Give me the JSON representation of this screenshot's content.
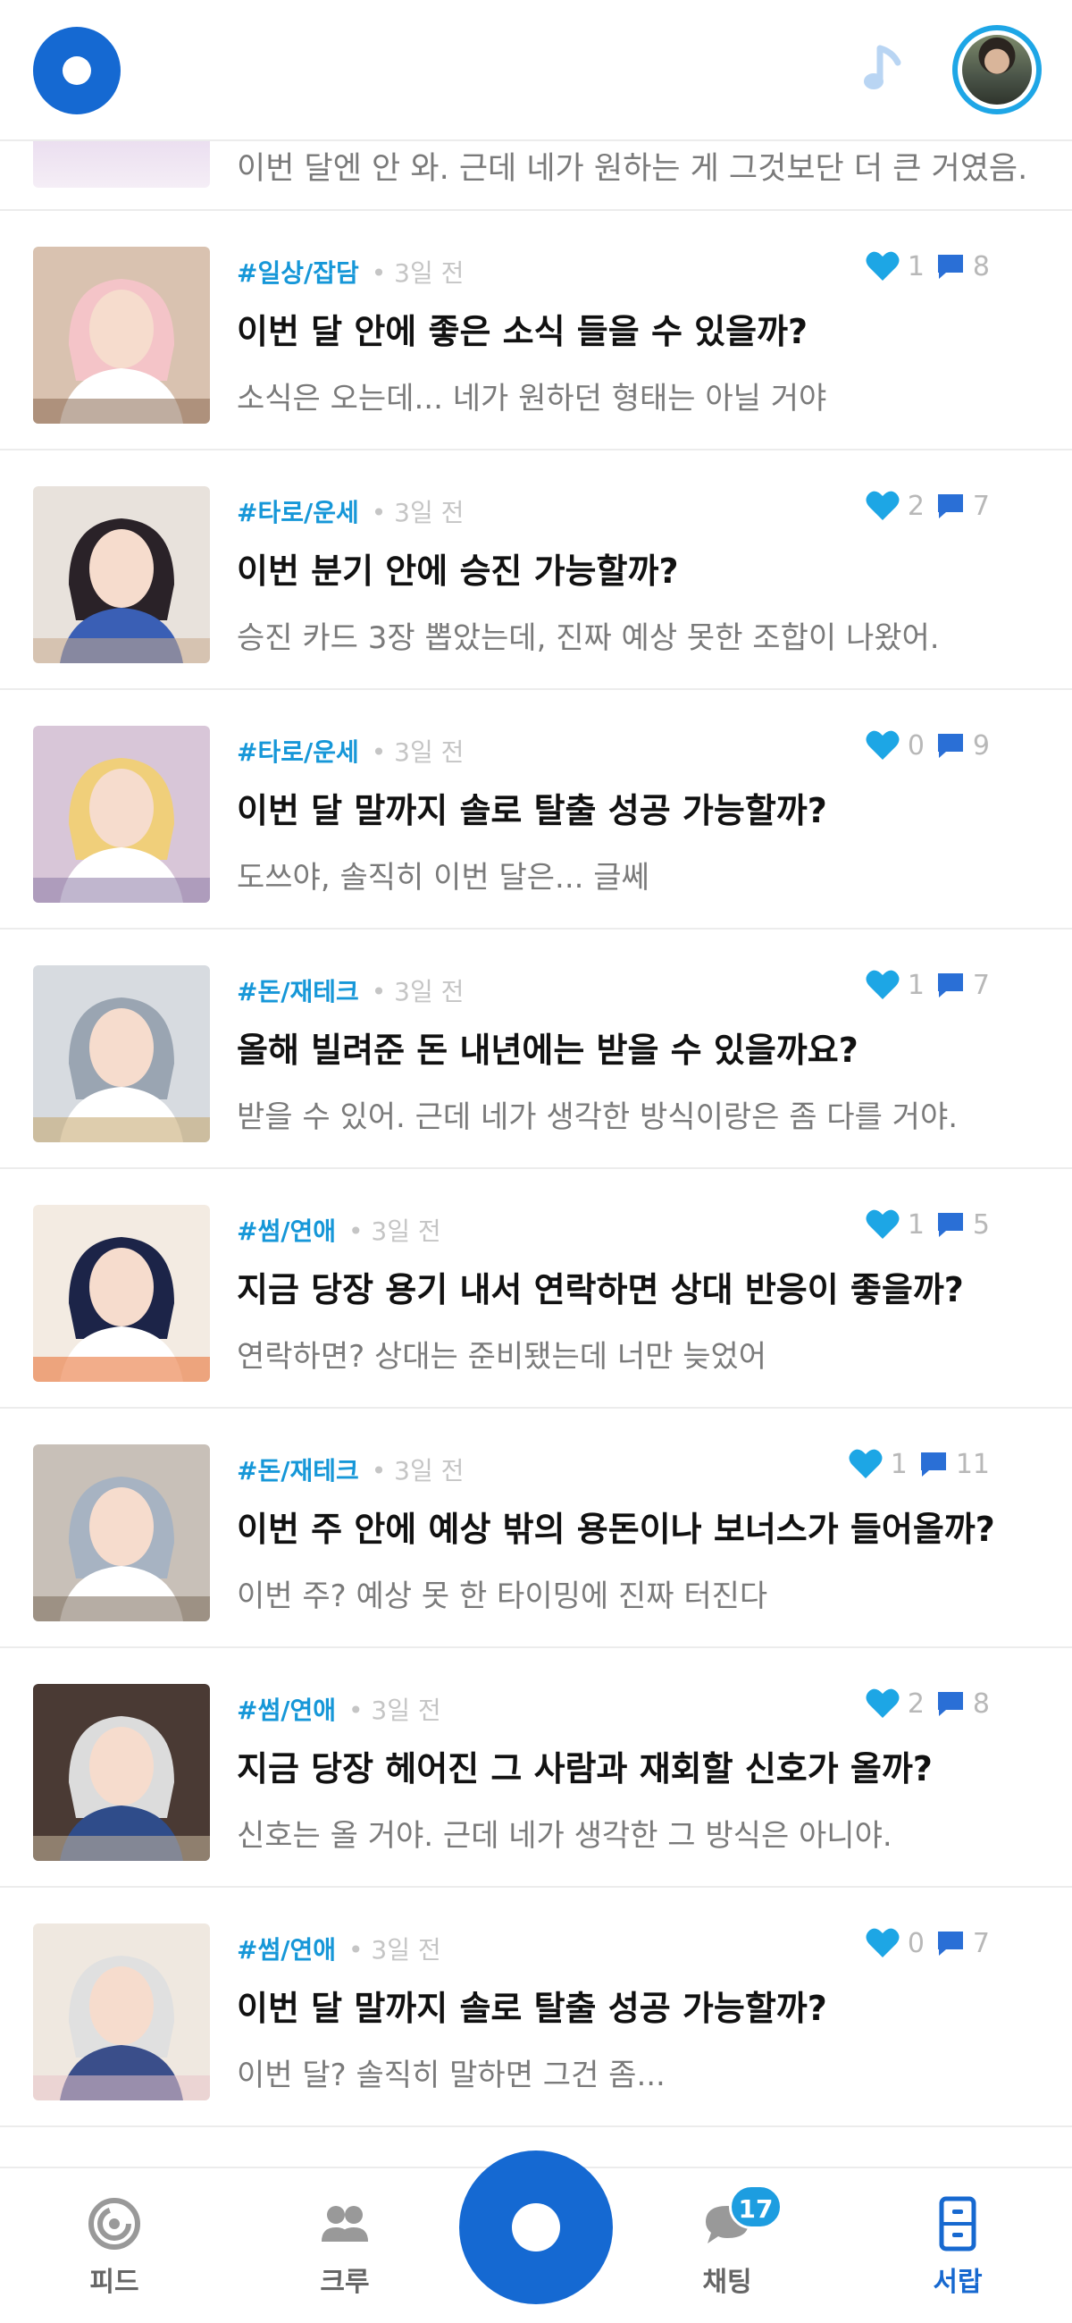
{
  "header": {
    "logo": "app-logo",
    "music_icon": "music-note-icon",
    "avatar": "profile-avatar"
  },
  "partial_row": {
    "preview": "이번 달엔 안 와. 근데 네가 원하는 게 그것보단 더 큰 거였음."
  },
  "posts": [
    {
      "tag": "#일상/잡담",
      "time": "• 3일 전",
      "likes": "1",
      "comments": "8",
      "title": "이번 달 안에 좋은 소식 들을 수 있을까?",
      "preview": "소식은 오는데... 네가 원하던 형태는 아닐 거야"
    },
    {
      "tag": "#타로/운세",
      "time": "• 3일 전",
      "likes": "2",
      "comments": "7",
      "title": "이번 분기 안에 승진 가능할까?",
      "preview": "승진 카드 3장 뽑았는데, 진짜 예상 못한 조합이 나왔어."
    },
    {
      "tag": "#타로/운세",
      "time": "• 3일 전",
      "likes": "0",
      "comments": "9",
      "title": "이번 달 말까지 솔로 탈출 성공 가능할까?",
      "preview": "도쓰야, 솔직히 이번 달은... 글쎄"
    },
    {
      "tag": "#돈/재테크",
      "time": "• 3일 전",
      "likes": "1",
      "comments": "7",
      "title": "올해 빌려준 돈 내년에는 받을 수 있을까요?",
      "preview": "받을 수 있어. 근데 네가 생각한 방식이랑은 좀 다를 거야."
    },
    {
      "tag": "#썸/연애",
      "time": "• 3일 전",
      "likes": "1",
      "comments": "5",
      "title": "지금 당장 용기 내서 연락하면 상대 반응이 좋을까?",
      "preview": "연락하면? 상대는 준비됐는데 너만 늦었어"
    },
    {
      "tag": "#돈/재테크",
      "time": "• 3일 전",
      "likes": "1",
      "comments": "11",
      "title": "이번 주 안에 예상 밖의 용돈이나 보너스가 들어올까?",
      "preview": "이번 주? 예상 못 한 타이밍에 진짜 터진다"
    },
    {
      "tag": "#썸/연애",
      "time": "• 3일 전",
      "likes": "2",
      "comments": "8",
      "title": "지금 당장 헤어진 그 사람과 재회할 신호가 올까?",
      "preview": "신호는 올 거야. 근데 네가 생각한 그 방식은 아니야."
    },
    {
      "tag": "#썸/연애",
      "time": "• 3일 전",
      "likes": "0",
      "comments": "7",
      "title": "이번 달 말까지 솔로 탈출 성공 가능할까?",
      "preview": "이번 달? 솔직히 말하면 그건 좀..."
    }
  ],
  "nav": {
    "feed": "피드",
    "crew": "크루",
    "chat": "채팅",
    "chat_badge": "17",
    "library": "서랍"
  },
  "colors": {
    "brand_blue": "#1569d2",
    "accent_blue": "#1697d8",
    "heart": "#1da6e5",
    "bubble": "#2a6fd6"
  }
}
